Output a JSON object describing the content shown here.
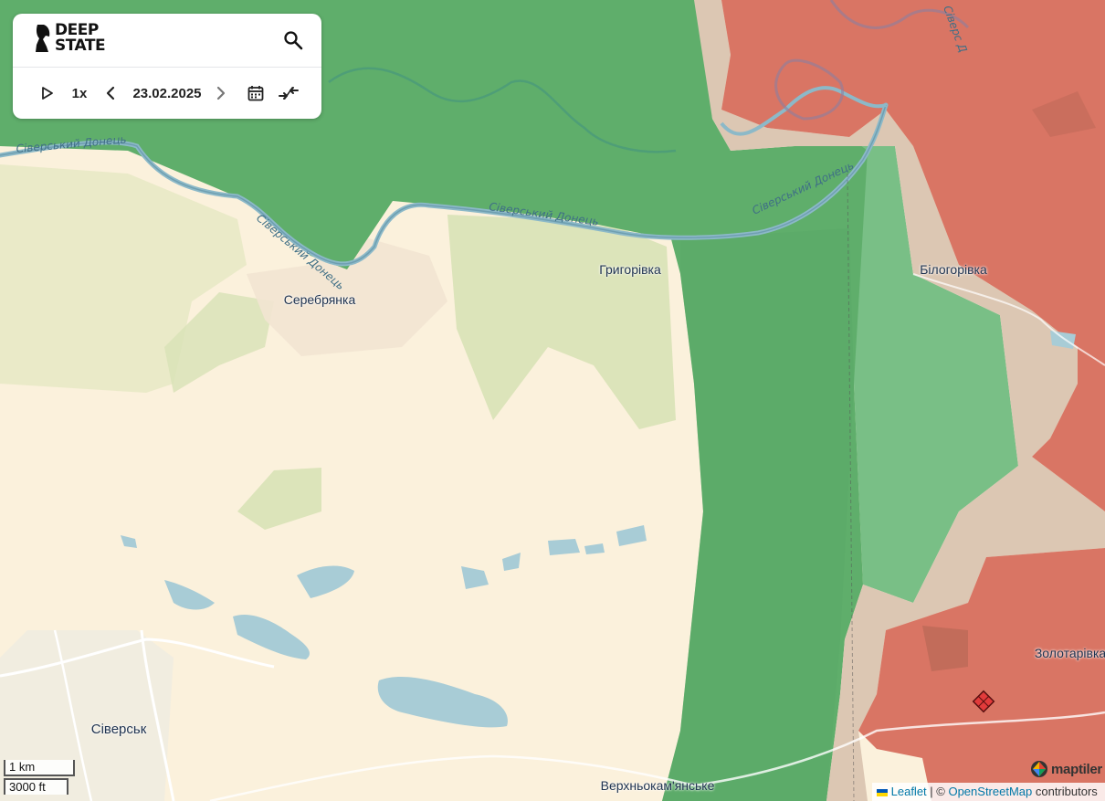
{
  "panel": {
    "logo_line1": "DEEP",
    "logo_line2": "STATE",
    "speed": "1x",
    "date": "23.02.2025"
  },
  "labels": {
    "serebrianka": "Серебрянка",
    "hryhorivka": "Григорівка",
    "bilohorivka": "Білогорівка",
    "zolotarivka": "Золотарівка",
    "siversk": "Сіверськ",
    "verkhnokamianske": "Верхньокам'янське",
    "river_1": "Сіверський Донець",
    "river_2": "Сіверський Донець",
    "river_3": "Сіверський Донець",
    "river_4": "Сіверський Донець",
    "river_5": "Сіверс Д"
  },
  "scale": {
    "metric": "1 km",
    "imperial": "3000 ft"
  },
  "attribution": {
    "leaflet": "Leaflet",
    "separator": " | © ",
    "osm": "OpenStreetMap",
    "contributors": " contributors"
  },
  "maptiler": {
    "text": "maptiler"
  },
  "colors": {
    "liberated": "#5fae6b",
    "light_green": "#79bf86",
    "occupied": "#d97564",
    "contested": "#dcc7b3",
    "land": "#fbf1dc",
    "water": "#a8ccd6"
  }
}
